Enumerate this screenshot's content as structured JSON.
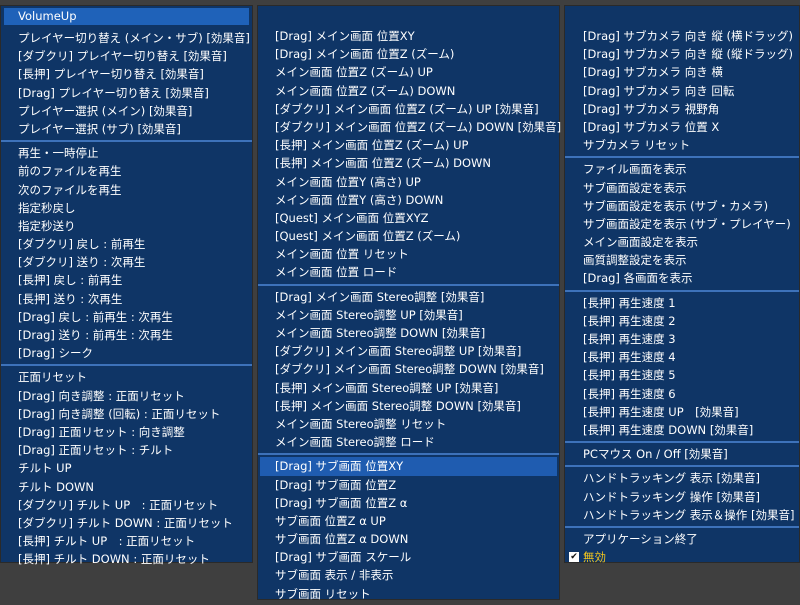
{
  "col1": {
    "header": "VolumeUp",
    "groups": [
      [
        "プレイヤー切り替え (メイン・サブ) [効果音]",
        "[ダブクリ] プレイヤー切り替え [効果音]",
        "[長押] プレイヤー切り替え [効果音]",
        "[Drag] プレイヤー切り替え [効果音]",
        "プレイヤー選択 (メイン) [効果音]",
        "プレイヤー選択 (サブ) [効果音]"
      ],
      [
        "再生・一時停止",
        "前のファイルを再生",
        "次のファイルを再生",
        "指定秒戻し",
        "指定秒送り",
        "[ダブクリ] 戻し : 前再生",
        "[ダブクリ] 送り : 次再生",
        "[長押] 戻し : 前再生",
        "[長押] 送り : 次再生",
        "[Drag] 戻し : 前再生 : 次再生",
        "[Drag] 送り : 前再生 : 次再生",
        "[Drag] シーク"
      ],
      [
        "正面リセット",
        "[Drag] 向き調整 : 正面リセット",
        "[Drag] 向き調整 (回転) : 正面リセット",
        "[Drag] 正面リセット : 向き調整",
        "[Drag] 正面リセット : チルト",
        "チルト UP",
        "チルト DOWN",
        "[ダブクリ] チルト UP　: 正面リセット",
        "[ダブクリ] チルト DOWN : 正面リセット",
        "[長押] チルト UP　: 正面リセット",
        "[長押] チルト DOWN : 正面リセット"
      ]
    ]
  },
  "col2": {
    "groups": [
      [
        "[Drag] メイン画面 位置XY",
        "[Drag] メイン画面 位置Z (ズーム)",
        "メイン画面 位置Z (ズーム) UP",
        "メイン画面 位置Z (ズーム) DOWN",
        "[ダブクリ] メイン画面 位置Z (ズーム) UP [効果音]",
        "[ダブクリ] メイン画面 位置Z (ズーム) DOWN [効果音]",
        "[長押] メイン画面 位置Z (ズーム) UP",
        "[長押] メイン画面 位置Z (ズーム) DOWN",
        "メイン画面 位置Y (高さ) UP",
        "メイン画面 位置Y (高さ) DOWN",
        "[Quest] メイン画面 位置XYZ",
        "[Quest] メイン画面 位置Z (ズーム)",
        "メイン画面 位置 リセット",
        "メイン画面 位置 ロード"
      ],
      [
        "[Drag] メイン画面 Stereo調整 [効果音]",
        "メイン画面 Stereo調整 UP [効果音]",
        "メイン画面 Stereo調整 DOWN [効果音]",
        "[ダブクリ] メイン画面 Stereo調整 UP [効果音]",
        "[ダブクリ] メイン画面 Stereo調整 DOWN [効果音]",
        "[長押] メイン画面 Stereo調整 UP [効果音]",
        "[長押] メイン画面 Stereo調整 DOWN [効果音]",
        "メイン画面 Stereo調整 リセット",
        "メイン画面 Stereo調整 ロード"
      ],
      [
        "[Drag] サブ画面 位置XY",
        "[Drag] サブ画面 位置Z",
        "[Drag] サブ画面 位置Z α",
        "サブ画面 位置Z α UP",
        "サブ画面 位置Z α DOWN",
        "[Drag] サブ画面 スケール",
        "サブ画面 表示 / 非表示",
        "サブ画面 リセット"
      ]
    ],
    "highlighted": "[Drag] サブ画面 位置XY"
  },
  "col3": {
    "groups": [
      [
        "[Drag] サブカメラ 向き 縦 (横ドラッグ)",
        "[Drag] サブカメラ 向き 縦 (縦ドラッグ)",
        "[Drag] サブカメラ 向き 横",
        "[Drag] サブカメラ 向き 回転",
        "[Drag] サブカメラ 視野角",
        "[Drag] サブカメラ 位置 X",
        "サブカメラ リセット"
      ],
      [
        "ファイル画面を表示",
        "サブ画面設定を表示",
        "サブ画面設定を表示 (サブ・カメラ)",
        "サブ画面設定を表示 (サブ・プレイヤー)",
        "メイン画面設定を表示",
        "画質調整設定を表示",
        "[Drag] 各画面を表示"
      ],
      [
        "[長押] 再生速度 1",
        "[長押] 再生速度 2",
        "[長押] 再生速度 3",
        "[長押] 再生速度 4",
        "[長押] 再生速度 5",
        "[長押] 再生速度 6",
        "[長押] 再生速度 UP　[効果音]",
        "[長押] 再生速度 DOWN [効果音]"
      ],
      [
        "PCマウス On / Off [効果音]"
      ],
      [
        "ハンドトラッキング 表示 [効果音]",
        "ハンドトラッキング 操作 [効果音]",
        "ハンドトラッキング 表示＆操作 [効果音]"
      ],
      [
        "アプリケーション終了"
      ]
    ],
    "checkbox": {
      "label": "無効",
      "checked": true,
      "mark": "✔"
    }
  },
  "colors": {
    "panel": "#0f3566",
    "highlight": "#1f5cb0",
    "separator": "#3d72ba",
    "background": "#3f3f3f",
    "check_label": "#f2c51d"
  }
}
